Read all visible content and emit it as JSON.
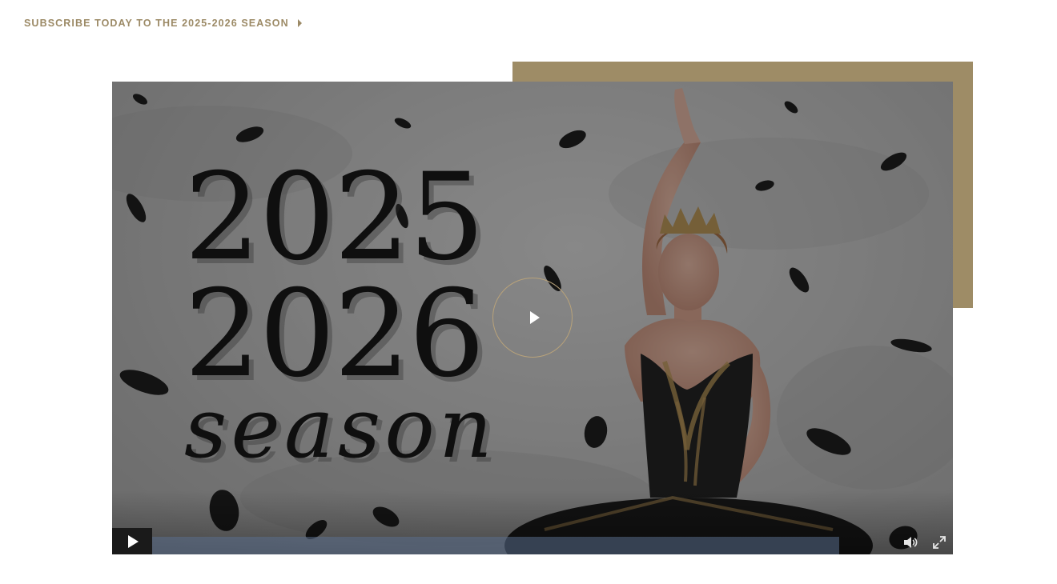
{
  "header": {
    "subscribe_text": "SUBSCRIBE TODAY TO THE 2025-2026 SEASON",
    "caret_icon": "caret-right-icon"
  },
  "video": {
    "poster": {
      "year_line_1": "2025",
      "year_line_2": "2026",
      "word": "season"
    },
    "big_play_icon": "play-icon",
    "controls": {
      "play_icon": "play-icon",
      "progress_fraction": 0,
      "volume_icon": "volume-icon",
      "fullscreen_icon": "fullscreen-icon"
    }
  },
  "colors": {
    "accent_gold": "#9e8c66",
    "link_gold": "#9c8a66",
    "progress_track": "#5a6e8c"
  }
}
